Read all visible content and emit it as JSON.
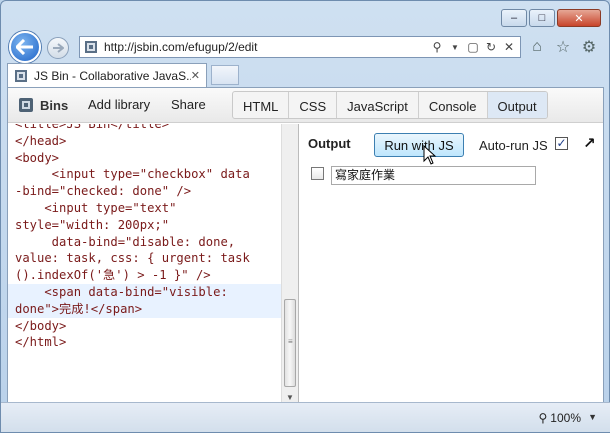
{
  "browser": {
    "url": "http://jsbin.com/efugup/2/edit",
    "tab_title": "JS Bin - Collaborative JavaS...",
    "zoom": "100%"
  },
  "jsbin": {
    "logo": "Bins",
    "menu": [
      "Add library",
      "Share"
    ],
    "panels": [
      {
        "label": "HTML",
        "active": false
      },
      {
        "label": "CSS",
        "active": false
      },
      {
        "label": "JavaScript",
        "active": false
      },
      {
        "label": "Console",
        "active": false
      },
      {
        "label": "Output",
        "active": true
      }
    ]
  },
  "editor": {
    "lines": [
      "<title>JS Bin</title>",
      "</head>",
      "<body>",
      "     <input type=\"checkbox\" data",
      "-bind=\"checked: done\" />",
      "    <input type=\"text\"",
      "style=\"width: 200px;\"",
      "     data-bind=\"disable: done,",
      "value: task, css: { urgent: task",
      "().indexOf('急') > -1 }\" />",
      "    <span data-bind=\"visible:",
      "done\">完成!</span>",
      "",
      "</body>",
      "</html>"
    ]
  },
  "output": {
    "label": "Output",
    "run_button": "Run with JS",
    "autorun_label": "Auto-run JS",
    "autorun_checked": true,
    "autorun_mark": "✓",
    "todo_value": "寫家庭作業",
    "todo_done": false
  },
  "icons": {
    "back": "back-arrow-icon",
    "forward": "forward-arrow-icon",
    "search": "search-icon",
    "refresh": "refresh-icon",
    "stop": "stop-icon",
    "home": "home-icon",
    "favorites": "star-icon",
    "settings": "gear-icon"
  }
}
